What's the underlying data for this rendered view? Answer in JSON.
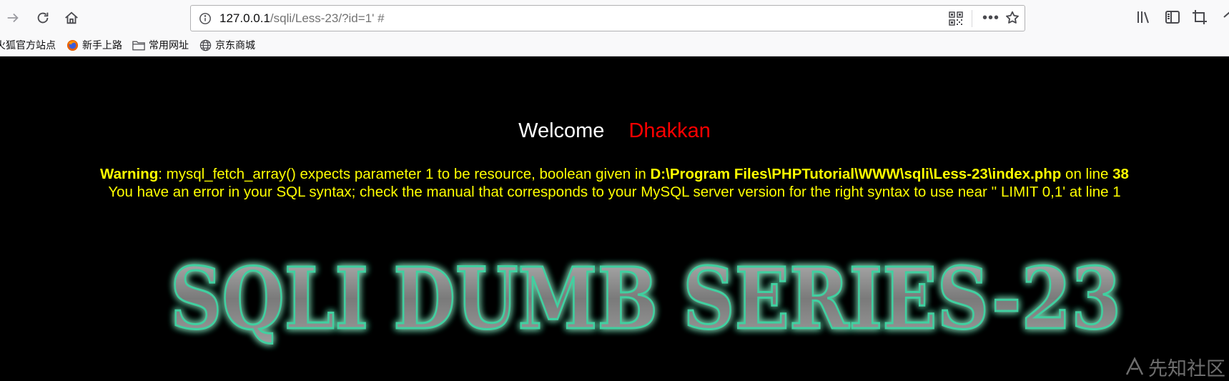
{
  "browser": {
    "url_host": "127.0.0.1",
    "url_path": "/sqli/Less-23/?id=1' #",
    "bookmarks": [
      {
        "label": "火狐官方站点",
        "icon": "firefox-icon"
      },
      {
        "label": "新手上路",
        "icon": "firefox-icon"
      },
      {
        "label": "常用网址",
        "icon": "folder-icon"
      },
      {
        "label": "京东商城",
        "icon": "globe-icon"
      }
    ],
    "icons": {
      "back": "arrow-right-icon",
      "reload": "reload-icon",
      "home": "home-icon",
      "info": "info-icon",
      "qr": "qr-code-icon",
      "more": "more-icon",
      "star": "star-icon",
      "library": "library-icon",
      "sidebar": "sidebar-icon",
      "crop": "crop-icon"
    }
  },
  "page": {
    "welcome": "Welcome",
    "name": "Dhakkan",
    "warning_label": "Warning",
    "warning_text": ": mysql_fetch_array() expects parameter 1 to be resource, boolean given in ",
    "warning_file": "D:\\Program Files\\PHPTutorial\\WWW\\sqli\\Less-23\\index.php",
    "warning_online": " on line ",
    "warning_line": "38",
    "sql_error": "You have an error in your SQL syntax; check the manual that corresponds to your MySQL server version for the right syntax to use near '' LIMIT 0,1' at line 1",
    "logo_text": "SQLI DUMB SERIES-23",
    "watermark": "先知社区"
  },
  "colors": {
    "welcome": "#ffffff",
    "name": "#ff0000",
    "warning": "#ffff00",
    "logo_fill": "#8a8a8a",
    "logo_glow": "#3fd0a0"
  }
}
